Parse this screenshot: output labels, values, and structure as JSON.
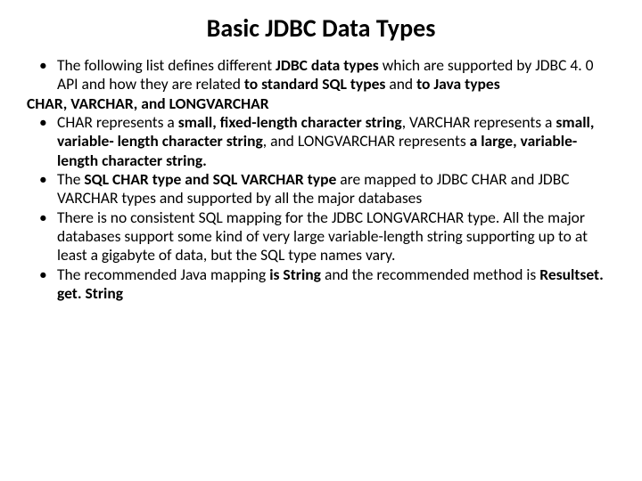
{
  "title": "Basic JDBC Data Types",
  "items": [
    {
      "kind": "bullet",
      "runs": [
        {
          "t": "The following list defines different ",
          "b": false
        },
        {
          "t": "JDBC data types ",
          "b": true
        },
        {
          "t": "which are supported by JDBC 4. 0 API and how they are related ",
          "b": false
        },
        {
          "t": "to standard SQL types ",
          "b": true
        },
        {
          "t": "and ",
          "b": false
        },
        {
          "t": "to Java types",
          "b": true
        }
      ]
    },
    {
      "kind": "flush",
      "runs": [
        {
          "t": "CHAR, VARCHAR, and LONGVARCHAR",
          "b": true
        }
      ]
    },
    {
      "kind": "bullet",
      "runs": [
        {
          "t": " CHAR represents a ",
          "b": false
        },
        {
          "t": "small, fixed-length character string",
          "b": true
        },
        {
          "t": ", VARCHAR represents a ",
          "b": false
        },
        {
          "t": "small, variable- length character string",
          "b": true
        },
        {
          "t": ", and LONGVARCHAR represents ",
          "b": false
        },
        {
          "t": "a large, variable-length character string.",
          "b": true
        }
      ]
    },
    {
      "kind": "bullet",
      "runs": [
        {
          "t": "The ",
          "b": false
        },
        {
          "t": "SQL CHAR type and  SQL VARCHAR type ",
          "b": true
        },
        {
          "t": "are mapped to JDBC CHAR and JDBC VARCHAR types and supported by all the major databases",
          "b": false
        }
      ]
    },
    {
      "kind": "bullet",
      "runs": [
        {
          "t": "There is no consistent SQL mapping for the JDBC LONGVARCHAR type. All the major databases support some kind of very large variable-length string supporting up to at least a gigabyte of data, but the SQL type names vary.",
          "b": false
        }
      ]
    },
    {
      "kind": "bullet",
      "runs": [
        {
          "t": "The recommended Java mapping ",
          "b": false
        },
        {
          "t": "is String  ",
          "b": true
        },
        {
          "t": "and the recommended method is ",
          "b": false
        },
        {
          "t": "Resultset. get. String",
          "b": true
        }
      ]
    }
  ]
}
